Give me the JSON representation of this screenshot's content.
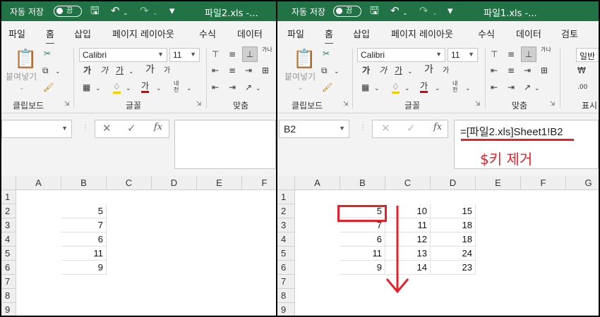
{
  "common": {
    "autosave_label": "자동 저장",
    "toggle_state": "끔",
    "tabs": [
      "파일",
      "홈",
      "삽입",
      "페이지 레이아웃",
      "수식",
      "데이터"
    ],
    "right_extra_tab": "검토",
    "font_name": "Calibri",
    "font_size": "11",
    "paste_label": "붙여넣기",
    "clipboard_group": "클립보드",
    "font_group": "글꼴",
    "align_group": "맞춤",
    "number_group_partial": "표시",
    "number_format_partial": "일반",
    "bold": "가",
    "italic": "가",
    "underline": "가",
    "font_color_glyph": "가",
    "grow_font": "가",
    "shrink_font": "가",
    "wrap_text": "가나",
    "phonetic": "내천",
    "accent_green": "#217346",
    "annotation_red": "#e8202a"
  },
  "left": {
    "filename": "파일2.xls  -...",
    "namebox": "",
    "formula": "",
    "columns": [
      "A",
      "B",
      "C",
      "D",
      "E",
      "F"
    ],
    "rows": [
      "1",
      "2",
      "3",
      "4",
      "5",
      "6",
      "7",
      "8",
      "9"
    ],
    "cells": [
      {
        "row": "2",
        "col": "B",
        "value": "5"
      },
      {
        "row": "3",
        "col": "B",
        "value": "7"
      },
      {
        "row": "4",
        "col": "B",
        "value": "6"
      },
      {
        "row": "5",
        "col": "B",
        "value": "11"
      },
      {
        "row": "6",
        "col": "B",
        "value": "9"
      }
    ]
  },
  "right": {
    "filename": "파일1.xls  -...",
    "namebox": "B2",
    "formula": "=[파일2.xls]Sheet1!B2",
    "annotation": "$키 제거",
    "columns": [
      "A",
      "B",
      "C",
      "D",
      "E",
      "F",
      "G"
    ],
    "rows": [
      "1",
      "2",
      "3",
      "4",
      "5",
      "6",
      "7",
      "8",
      "9"
    ],
    "table": [
      {
        "row": "2",
        "B": "5",
        "C": "10",
        "D": "15"
      },
      {
        "row": "3",
        "B": "7",
        "C": "11",
        "D": "18"
      },
      {
        "row": "4",
        "B": "6",
        "C": "12",
        "D": "18"
      },
      {
        "row": "5",
        "B": "11",
        "C": "13",
        "D": "24"
      },
      {
        "row": "6",
        "B": "9",
        "C": "14",
        "D": "23"
      }
    ]
  }
}
